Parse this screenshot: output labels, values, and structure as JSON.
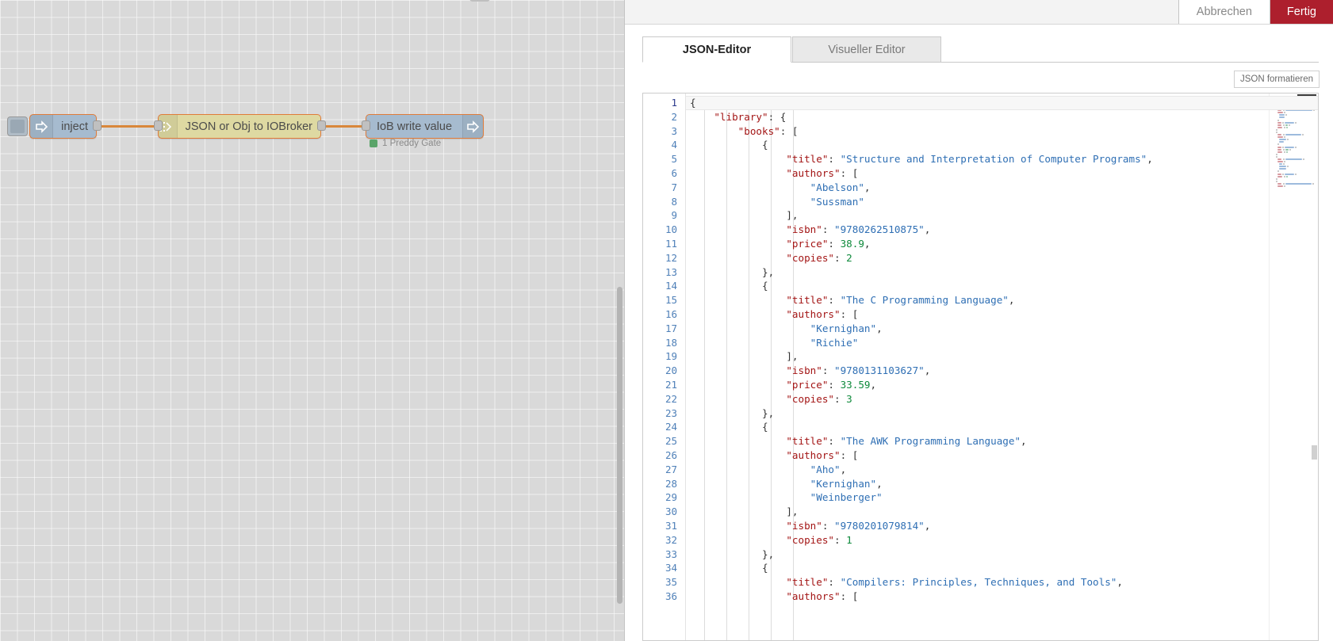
{
  "dialog": {
    "cancel_label": "Abbrechen",
    "done_label": "Fertig",
    "format_label": "JSON formatieren",
    "accent_done_color": "#ad1f2d"
  },
  "tabs": [
    {
      "label": "JSON-Editor",
      "active": true
    },
    {
      "label": "Visueller Editor",
      "active": false
    }
  ],
  "flow": {
    "nodes": [
      {
        "name": "inject",
        "label": "inject",
        "color": "#a6bbcf",
        "icon": "arrow-right-icon"
      },
      {
        "name": "json-or-obj-to-iobroker",
        "label": "JSON or Obj to IOBroker",
        "color": "#ded9a2",
        "icon": "dots-grid-icon"
      },
      {
        "name": "iob-write-value",
        "label": "IoB write value",
        "color": "#a6bbcf",
        "icon": "arrow-right-icon"
      }
    ],
    "status": {
      "text": "1 Preddy Gate",
      "dot_color": "#5aa469"
    }
  },
  "editor": {
    "active_line": 1,
    "colors": {
      "key": "#a31515",
      "string": "#2f6fb4",
      "number": "#0f8a3c",
      "punct": "#333333"
    },
    "lines": [
      {
        "n": 1,
        "indent": 0,
        "tokens": [
          {
            "t": "pun",
            "v": "{"
          }
        ]
      },
      {
        "n": 2,
        "indent": 1,
        "tokens": [
          {
            "t": "key",
            "v": "\"library\""
          },
          {
            "t": "pun",
            "v": ": {"
          }
        ]
      },
      {
        "n": 3,
        "indent": 2,
        "tokens": [
          {
            "t": "key",
            "v": "\"books\""
          },
          {
            "t": "pun",
            "v": ": ["
          }
        ]
      },
      {
        "n": 4,
        "indent": 3,
        "tokens": [
          {
            "t": "pun",
            "v": "{"
          }
        ]
      },
      {
        "n": 5,
        "indent": 4,
        "tokens": [
          {
            "t": "key",
            "v": "\"title\""
          },
          {
            "t": "pun",
            "v": ": "
          },
          {
            "t": "str",
            "v": "\"Structure and Interpretation of Computer Programs\""
          },
          {
            "t": "pun",
            "v": ","
          }
        ]
      },
      {
        "n": 6,
        "indent": 4,
        "tokens": [
          {
            "t": "key",
            "v": "\"authors\""
          },
          {
            "t": "pun",
            "v": ": ["
          }
        ]
      },
      {
        "n": 7,
        "indent": 5,
        "tokens": [
          {
            "t": "str",
            "v": "\"Abelson\""
          },
          {
            "t": "pun",
            "v": ","
          }
        ]
      },
      {
        "n": 8,
        "indent": 5,
        "tokens": [
          {
            "t": "str",
            "v": "\"Sussman\""
          }
        ]
      },
      {
        "n": 9,
        "indent": 4,
        "tokens": [
          {
            "t": "pun",
            "v": "],"
          }
        ]
      },
      {
        "n": 10,
        "indent": 4,
        "tokens": [
          {
            "t": "key",
            "v": "\"isbn\""
          },
          {
            "t": "pun",
            "v": ": "
          },
          {
            "t": "str",
            "v": "\"9780262510875\""
          },
          {
            "t": "pun",
            "v": ","
          }
        ]
      },
      {
        "n": 11,
        "indent": 4,
        "tokens": [
          {
            "t": "key",
            "v": "\"price\""
          },
          {
            "t": "pun",
            "v": ": "
          },
          {
            "t": "num",
            "v": "38.9"
          },
          {
            "t": "pun",
            "v": ","
          }
        ]
      },
      {
        "n": 12,
        "indent": 4,
        "tokens": [
          {
            "t": "key",
            "v": "\"copies\""
          },
          {
            "t": "pun",
            "v": ": "
          },
          {
            "t": "num",
            "v": "2"
          }
        ]
      },
      {
        "n": 13,
        "indent": 3,
        "tokens": [
          {
            "t": "pun",
            "v": "},"
          }
        ]
      },
      {
        "n": 14,
        "indent": 3,
        "tokens": [
          {
            "t": "pun",
            "v": "{"
          }
        ]
      },
      {
        "n": 15,
        "indent": 4,
        "tokens": [
          {
            "t": "key",
            "v": "\"title\""
          },
          {
            "t": "pun",
            "v": ": "
          },
          {
            "t": "str",
            "v": "\"The C Programming Language\""
          },
          {
            "t": "pun",
            "v": ","
          }
        ]
      },
      {
        "n": 16,
        "indent": 4,
        "tokens": [
          {
            "t": "key",
            "v": "\"authors\""
          },
          {
            "t": "pun",
            "v": ": ["
          }
        ]
      },
      {
        "n": 17,
        "indent": 5,
        "tokens": [
          {
            "t": "str",
            "v": "\"Kernighan\""
          },
          {
            "t": "pun",
            "v": ","
          }
        ]
      },
      {
        "n": 18,
        "indent": 5,
        "tokens": [
          {
            "t": "str",
            "v": "\"Richie\""
          }
        ]
      },
      {
        "n": 19,
        "indent": 4,
        "tokens": [
          {
            "t": "pun",
            "v": "],"
          }
        ]
      },
      {
        "n": 20,
        "indent": 4,
        "tokens": [
          {
            "t": "key",
            "v": "\"isbn\""
          },
          {
            "t": "pun",
            "v": ": "
          },
          {
            "t": "str",
            "v": "\"9780131103627\""
          },
          {
            "t": "pun",
            "v": ","
          }
        ]
      },
      {
        "n": 21,
        "indent": 4,
        "tokens": [
          {
            "t": "key",
            "v": "\"price\""
          },
          {
            "t": "pun",
            "v": ": "
          },
          {
            "t": "num",
            "v": "33.59"
          },
          {
            "t": "pun",
            "v": ","
          }
        ]
      },
      {
        "n": 22,
        "indent": 4,
        "tokens": [
          {
            "t": "key",
            "v": "\"copies\""
          },
          {
            "t": "pun",
            "v": ": "
          },
          {
            "t": "num",
            "v": "3"
          }
        ]
      },
      {
        "n": 23,
        "indent": 3,
        "tokens": [
          {
            "t": "pun",
            "v": "},"
          }
        ]
      },
      {
        "n": 24,
        "indent": 3,
        "tokens": [
          {
            "t": "pun",
            "v": "{"
          }
        ]
      },
      {
        "n": 25,
        "indent": 4,
        "tokens": [
          {
            "t": "key",
            "v": "\"title\""
          },
          {
            "t": "pun",
            "v": ": "
          },
          {
            "t": "str",
            "v": "\"The AWK Programming Language\""
          },
          {
            "t": "pun",
            "v": ","
          }
        ]
      },
      {
        "n": 26,
        "indent": 4,
        "tokens": [
          {
            "t": "key",
            "v": "\"authors\""
          },
          {
            "t": "pun",
            "v": ": ["
          }
        ]
      },
      {
        "n": 27,
        "indent": 5,
        "tokens": [
          {
            "t": "str",
            "v": "\"Aho\""
          },
          {
            "t": "pun",
            "v": ","
          }
        ]
      },
      {
        "n": 28,
        "indent": 5,
        "tokens": [
          {
            "t": "str",
            "v": "\"Kernighan\""
          },
          {
            "t": "pun",
            "v": ","
          }
        ]
      },
      {
        "n": 29,
        "indent": 5,
        "tokens": [
          {
            "t": "str",
            "v": "\"Weinberger\""
          }
        ]
      },
      {
        "n": 30,
        "indent": 4,
        "tokens": [
          {
            "t": "pun",
            "v": "],"
          }
        ]
      },
      {
        "n": 31,
        "indent": 4,
        "tokens": [
          {
            "t": "key",
            "v": "\"isbn\""
          },
          {
            "t": "pun",
            "v": ": "
          },
          {
            "t": "str",
            "v": "\"9780201079814\""
          },
          {
            "t": "pun",
            "v": ","
          }
        ]
      },
      {
        "n": 32,
        "indent": 4,
        "tokens": [
          {
            "t": "key",
            "v": "\"copies\""
          },
          {
            "t": "pun",
            "v": ": "
          },
          {
            "t": "num",
            "v": "1"
          }
        ]
      },
      {
        "n": 33,
        "indent": 3,
        "tokens": [
          {
            "t": "pun",
            "v": "},"
          }
        ]
      },
      {
        "n": 34,
        "indent": 3,
        "tokens": [
          {
            "t": "pun",
            "v": "{"
          }
        ]
      },
      {
        "n": 35,
        "indent": 4,
        "tokens": [
          {
            "t": "key",
            "v": "\"title\""
          },
          {
            "t": "pun",
            "v": ": "
          },
          {
            "t": "str",
            "v": "\"Compilers: Principles, Techniques, and Tools\""
          },
          {
            "t": "pun",
            "v": ","
          }
        ]
      },
      {
        "n": 36,
        "indent": 4,
        "tokens": [
          {
            "t": "key",
            "v": "\"authors\""
          },
          {
            "t": "pun",
            "v": ": ["
          }
        ]
      }
    ]
  }
}
